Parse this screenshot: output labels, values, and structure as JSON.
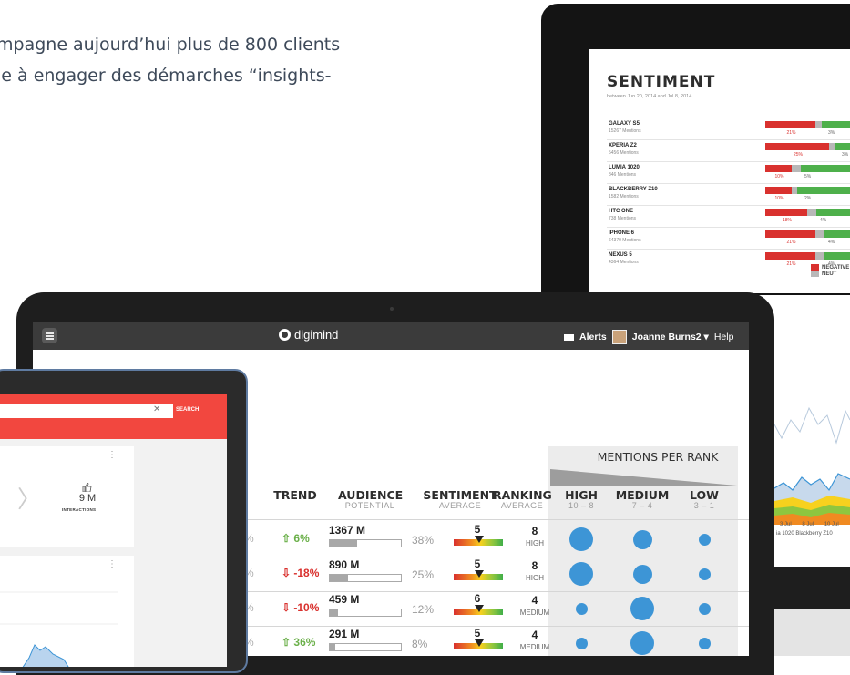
{
  "hero": {
    "line1": "mpagne aujourd’hui plus de 800 clients",
    "line2": "le à engager des démarches “insights-"
  },
  "sentiment_panel": {
    "title": "SENTIMENT",
    "subtitle": "between Jun 20, 2014 and Jul 8, 2014",
    "rows": [
      {
        "name": "GALAXY S5",
        "mentions": "15267 Mentions",
        "neg_pct": "21%",
        "neu_pct": "3%",
        "negative": 0.46,
        "neutral": 0.06
      },
      {
        "name": "XPERIA Z2",
        "mentions": "5456 Mentions",
        "neg_pct": "25%",
        "neu_pct": "3%",
        "negative": 0.58,
        "neutral": 0.06
      },
      {
        "name": "LUMIA 1020",
        "mentions": "846 Mentions",
        "neg_pct": "10%",
        "neu_pct": "5%",
        "negative": 0.24,
        "neutral": 0.08
      },
      {
        "name": "BLACKBERRY Z10",
        "mentions": "1582 Mentions",
        "neg_pct": "10%",
        "neu_pct": "2%",
        "negative": 0.24,
        "neutral": 0.05
      },
      {
        "name": "HTC ONE",
        "mentions": "738 Mentions",
        "neg_pct": "18%",
        "neu_pct": "4%",
        "negative": 0.38,
        "neutral": 0.08
      },
      {
        "name": "IPHONE 6",
        "mentions": "64370 Mentions",
        "neg_pct": "21%",
        "neu_pct": "4%",
        "negative": 0.46,
        "neutral": 0.08
      },
      {
        "name": "NEXUS 5",
        "mentions": "4364 Mentions",
        "neg_pct": "21%",
        "neu_pct": "4%",
        "negative": 0.46,
        "neutral": 0.08
      }
    ],
    "legend_negative": "NEGATIVE",
    "legend_neutral": "NEUT"
  },
  "app": {
    "brand": "digimind",
    "alerts": "Alerts",
    "user": "Joanne Burns2 ▾",
    "help": "Help"
  },
  "table": {
    "mentions_per_rank": "MENTIONS PER RANK",
    "headers": {
      "trend": "TREND",
      "audience": "AUDIENCE",
      "audience_sub": "POTENTIAL",
      "sentiment": "SENTIMENT",
      "sentiment_sub": "AVERAGE",
      "ranking": "RANKING",
      "ranking_sub": "AVERAGE",
      "high": "HIGH",
      "high_sub": "10 – 8",
      "medium": "MEDIUM",
      "medium_sub": "7 – 4",
      "low": "LOW",
      "low_sub": "3 – 1"
    },
    "rows": [
      {
        "trend": "⇧ 6%",
        "trend_dir": "up",
        "audience": "1367 M",
        "audience_pct": "38%",
        "audience_share": 0.38,
        "sentiment": "5",
        "ranking": "8",
        "ranking_label": "HIGH",
        "high": 0.9,
        "medium": 0.7,
        "low": 0.3
      },
      {
        "trend": "⇩ -18%",
        "trend_dir": "down",
        "audience": "890 M",
        "audience_pct": "25%",
        "audience_share": 0.25,
        "sentiment": "5",
        "ranking": "8",
        "ranking_label": "HIGH",
        "high": 0.9,
        "medium": 0.7,
        "low": 0.3
      },
      {
        "trend": "⇩ -10%",
        "trend_dir": "down",
        "audience": "459 M",
        "audience_pct": "12%",
        "audience_share": 0.12,
        "sentiment": "6",
        "ranking": "4",
        "ranking_label": "MEDIUM",
        "high": 0.3,
        "medium": 0.9,
        "low": 0.3
      },
      {
        "trend": "⇧ 36%",
        "trend_dir": "up",
        "audience": "291 M",
        "audience_pct": "8%",
        "audience_share": 0.08,
        "sentiment": "5",
        "ranking": "4",
        "ranking_label": "MEDIUM",
        "high": 0.3,
        "medium": 0.9,
        "low": 0.3
      }
    ],
    "cut_left_pct": "%"
  },
  "tablet": {
    "close": "✕",
    "search_button": "SEARCH",
    "interactions_value": "9 M",
    "interactions_label": "INTERACTIONS",
    "more": "⋮"
  },
  "right_chart": {
    "ticks": [
      "3 Jul",
      "8 Jul",
      "10 Jul"
    ],
    "legend": "ia 1020  Blackberry Z10"
  },
  "colors": {
    "negative": "#d9312e",
    "neutral": "#b8b8b8",
    "positive": "#4eb04b",
    "accent_red": "#f2473f",
    "dot_blue": "#3d95d6"
  }
}
